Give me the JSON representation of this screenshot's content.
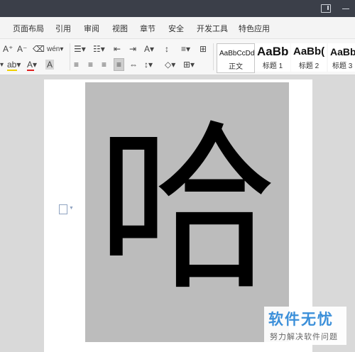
{
  "menubar": {
    "items": [
      "页面布局",
      "引用",
      "审阅",
      "视图",
      "章节",
      "安全",
      "开发工具",
      "特色应用"
    ]
  },
  "toolbar": {
    "row1": [
      "A⁺",
      "A⁻",
      "⌫",
      "wén▾",
      "☰▾",
      "☷▾",
      "⇤",
      "⇥",
      "A▾",
      "↕",
      "≡▾",
      "⊞"
    ],
    "row2": [
      "▾",
      "ab▾",
      "A▾",
      "A",
      "≡",
      "≡",
      "≡",
      "≡",
      "⇔",
      "↕▾",
      "◇▾",
      "⊞▾"
    ],
    "highlight_color": "#f0d000",
    "font_color": "#e02020"
  },
  "styles": [
    {
      "sample": "AaBbCcDd",
      "name": "正文"
    },
    {
      "sample": "AaBb",
      "name": "标题 1"
    },
    {
      "sample": "AaBb(",
      "name": "标题 2"
    },
    {
      "sample": "AaBb",
      "name": "标题 3"
    }
  ],
  "document": {
    "character": "哈",
    "image_bg": "#bcbcbc"
  },
  "watermark": {
    "title": "软件无忧",
    "subtitle": "努力解决软件问题",
    "color": "#3b8fd9"
  }
}
